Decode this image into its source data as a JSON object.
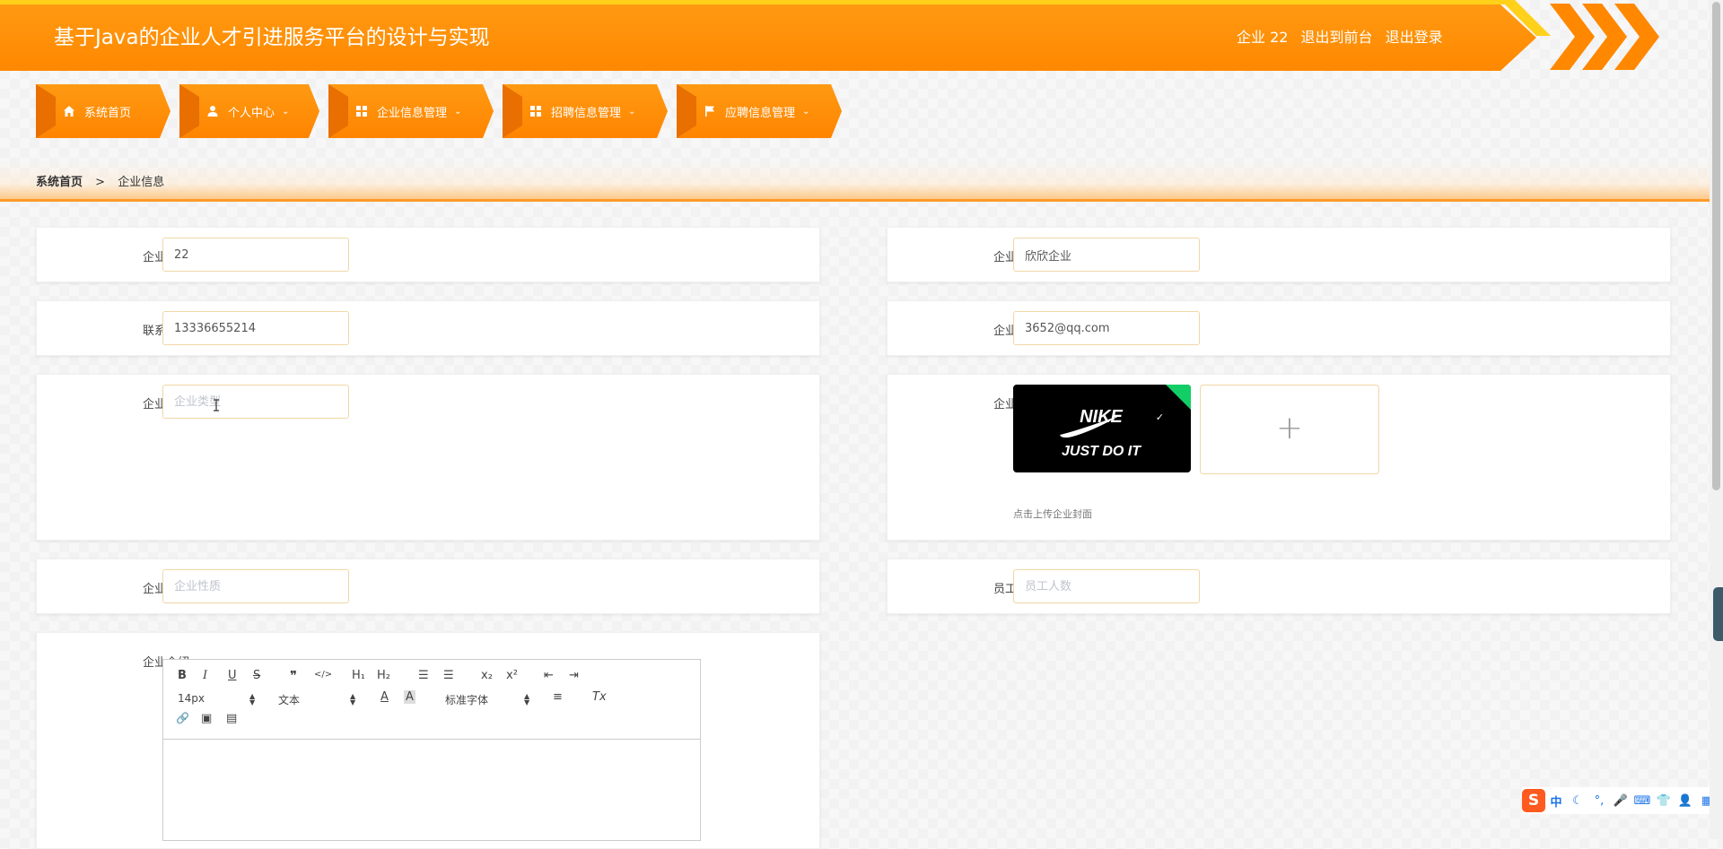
{
  "header": {
    "title": "基于Java的企业人才引进服务平台的设计与实现",
    "user_label": "企业 22",
    "front_link": "退出到前台",
    "logout_link": "退出登录"
  },
  "nav": {
    "items": [
      {
        "label": "系统首页",
        "icon": "home-icon",
        "has_dropdown": false
      },
      {
        "label": "个人中心",
        "icon": "user-icon",
        "has_dropdown": true
      },
      {
        "label": "企业信息管理",
        "icon": "grid-icon",
        "has_dropdown": true
      },
      {
        "label": "招聘信息管理",
        "icon": "grid-icon",
        "has_dropdown": true
      },
      {
        "label": "应聘信息管理",
        "icon": "flag-icon",
        "has_dropdown": true
      }
    ],
    "caret": "⌄"
  },
  "breadcrumb": {
    "home": "系统首页",
    "separator": ">",
    "current": "企业信息"
  },
  "form": {
    "account": {
      "label": "企业账号",
      "value": "22"
    },
    "name": {
      "label": "企业名称",
      "value": "欣欣企业"
    },
    "phone": {
      "label": "联系电话",
      "value": "13336655214"
    },
    "email": {
      "label": "企业邮箱",
      "value": "3652@qq.com"
    },
    "type": {
      "label": "企业类型",
      "value": "",
      "placeholder": "企业类型"
    },
    "cover": {
      "label": "企业封面",
      "tip": "点击上传企业封面",
      "add_symbol": "+",
      "image_text_1": "NIKE",
      "image_text_2": "JUST DO IT"
    },
    "nature": {
      "label": "企业性质",
      "value": "",
      "placeholder": "企业性质"
    },
    "employees": {
      "label": "员工人数",
      "value": "",
      "placeholder": "员工人数"
    },
    "intro": {
      "label": "企业介绍"
    }
  },
  "editor": {
    "bold": "B",
    "italic": "I",
    "underline": "U",
    "strike": "S",
    "quote": "❞",
    "code": "</>",
    "h1": "H₁",
    "h2": "H₂",
    "ordered_list": "☰",
    "bullet_list": "☰",
    "sub": "x₂",
    "sup": "x²",
    "outdent": "⇤",
    "indent": "⇥",
    "size": "14px",
    "format": "文本",
    "font": "标准字体",
    "color": "A",
    "background": "A",
    "align": "≡",
    "clean": "Tx",
    "link": "🔗",
    "image": "▣",
    "video": "▤"
  },
  "ime": {
    "logo": "S",
    "items": [
      "中",
      "☾",
      "°,",
      "🎤",
      "⌨",
      "👕",
      "👤",
      "▦"
    ]
  },
  "colors": {
    "accent": "#ff8800",
    "accent_light": "#ffd11a",
    "border": "#f1d7a6",
    "success": "#13ce66"
  }
}
